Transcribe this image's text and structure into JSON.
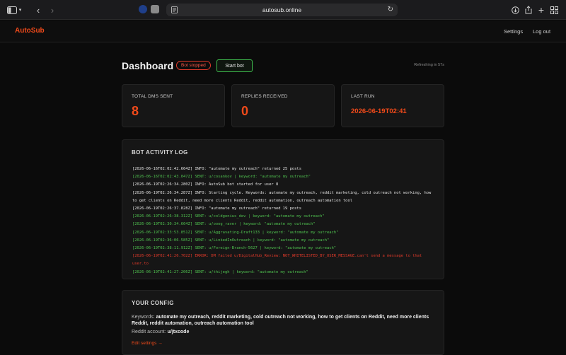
{
  "browser": {
    "url": "autosub.online"
  },
  "app": {
    "brand": "AutoSub",
    "nav": {
      "settings": "Settings",
      "logout": "Log out"
    },
    "colors": {
      "accent": "#f04a1a",
      "success": "#4fc04f",
      "error": "#e23a2a"
    }
  },
  "header": {
    "title": "Dashboard",
    "status_badge": "Bot stopped",
    "start_button": "Start bot",
    "refresh_text": "Refreshing in 57s"
  },
  "stats": [
    {
      "label": "TOTAL DMS SENT",
      "value": "8"
    },
    {
      "label": "REPLIES RECEIVED",
      "value": "0"
    },
    {
      "label": "LAST RUN",
      "value": "2026-06-19T02:41"
    }
  ],
  "log": {
    "title": "BOT ACTIVITY LOG",
    "entries": [
      {
        "level": "info",
        "text": "[2026-06-16T02:02:42.664Z] INFO: \"automate my outreach\" returned 25 posts"
      },
      {
        "level": "sent",
        "text": "[2026-06-16T02:02:43.047Z] SENT: u/cosankov | keyword: \"automate my outreach\""
      },
      {
        "level": "info",
        "text": "[2026-06-19T02:26:34.280Z] INFO: AutoSub bot started for user 8"
      },
      {
        "level": "info",
        "text": "[2026-06-19T02:26:34.287Z] INFO: Starting cycle. Keywords: automate my outreach, reddit marketing, cold outreach not working, how to get clients on Reddit, need more clients Reddit, reddit automation, outreach automation tool"
      },
      {
        "level": "info",
        "text": "[2026-06-19T02:26:37.828Z] INFO: \"automate my outreach\" returned 19 posts"
      },
      {
        "level": "sent",
        "text": "[2026-06-19T02:26:38.312Z] SENT: u/coldgenius_dev | keyword: \"automate my outreach\""
      },
      {
        "level": "sent",
        "text": "[2026-06-19T02:30:34.664Z] SENT: u/ooog_raver | keyword: \"automate my outreach\""
      },
      {
        "level": "sent",
        "text": "[2026-06-19T02:33:53.851Z] SENT: u/Aggravating-Draft133 | keyword: \"automate my outreach\""
      },
      {
        "level": "sent",
        "text": "[2026-06-19T02:36:06.585Z] SENT: u/LinkedInOutreach | keyword: \"automate my outreach\""
      },
      {
        "level": "sent",
        "text": "[2026-06-19T02:38:11.912Z] SENT: u/Foreign-Branch-5627 | keyword: \"automate my outreach\""
      },
      {
        "level": "error",
        "text": "[2026-06-19T02:41:26.702Z] ERROR: DM failed u/DigitalHub_Review: NOT_WHITELISTED_BY_USER_MESSAGE.can't send a message to that user.to"
      },
      {
        "level": "sent",
        "text": "[2026-06-19T02:41:27.206Z] SENT: u/thijegh | keyword: \"automate my outreach\""
      }
    ]
  },
  "config": {
    "title": "YOUR CONFIG",
    "keywords_label": "Keywords:",
    "keywords_value": "automate my outreach, reddit marketing, cold outreach not working, how to get clients on Reddit, need more clients Reddit, reddit automation, outreach automation tool",
    "account_label": "Reddit account:",
    "account_value": "u/jtxcode",
    "edit_link": "Edit settings →"
  }
}
